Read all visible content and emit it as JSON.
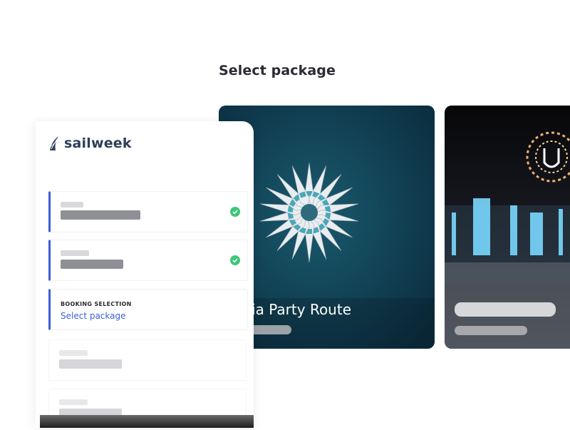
{
  "page": {
    "title": "Select package"
  },
  "brand": {
    "name": "sailweek",
    "color": "#2b3f58"
  },
  "colors": {
    "accent": "#3b5fd6",
    "success": "#3ec77a"
  },
  "steps": [
    {
      "state": "completed",
      "icon": "check-icon"
    },
    {
      "state": "completed",
      "icon": "check-icon"
    },
    {
      "state": "active",
      "category": "BOOKING SELECTION",
      "label": "Select package"
    },
    {
      "state": "pending"
    },
    {
      "state": "pending"
    }
  ],
  "packages": [
    {
      "name": "atia Party Route",
      "image": "aerial-yacht-flower-photo"
    },
    {
      "name": "",
      "image": "festival-stage-photo"
    }
  ]
}
